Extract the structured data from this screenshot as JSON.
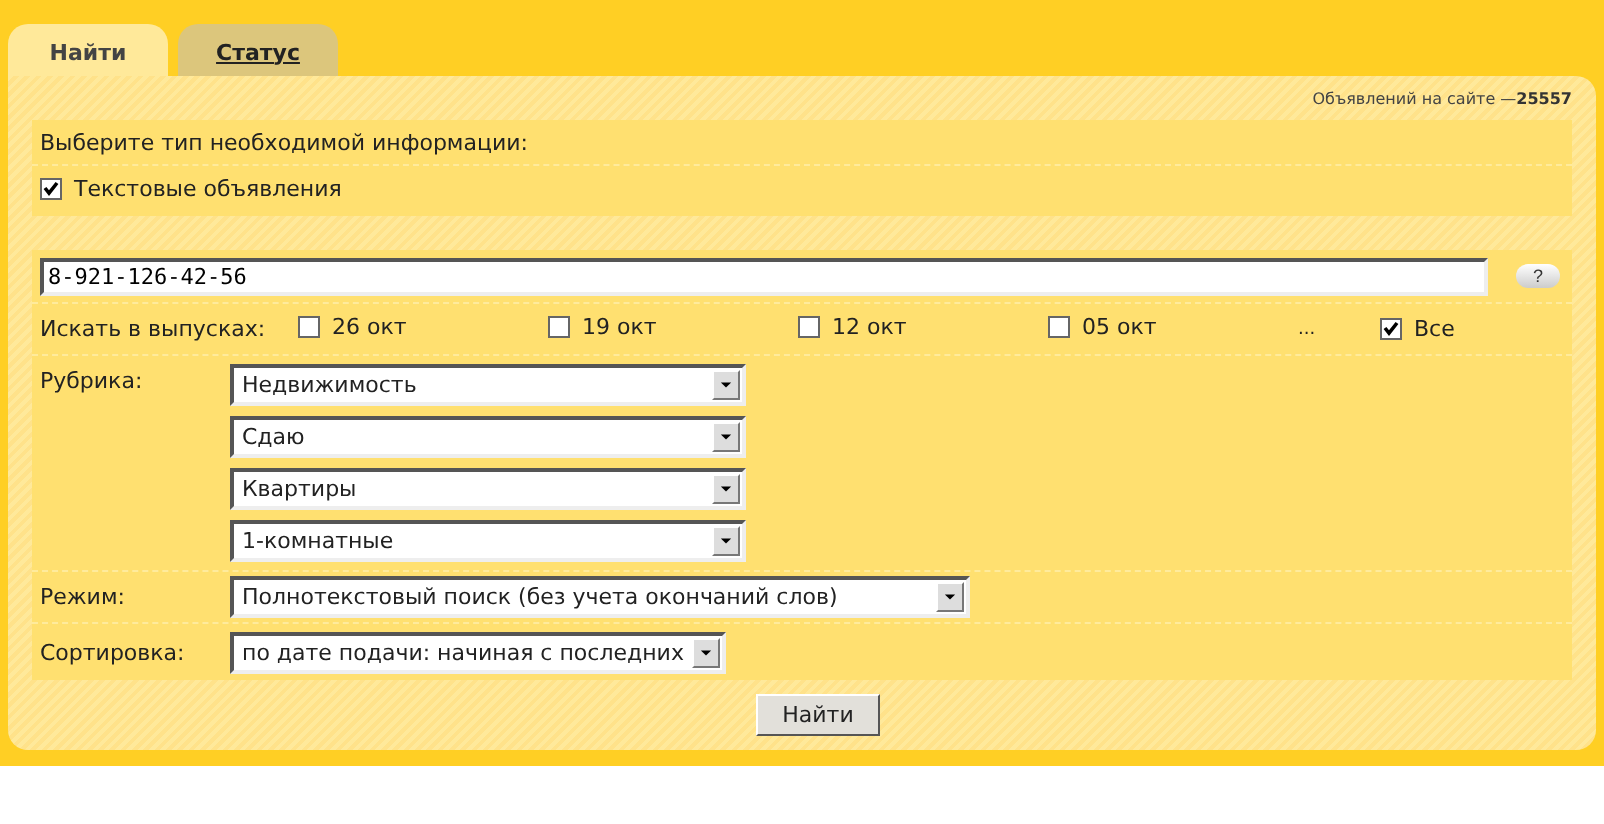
{
  "tabs": [
    {
      "label": "Найти",
      "selected": true
    },
    {
      "label": "Статус",
      "selected": false
    }
  ],
  "counter": {
    "label": "Объявлений на сайте —",
    "value": "25557"
  },
  "info_type": {
    "prompt": "Выберите тип необходимой информации:",
    "options": [
      {
        "label": "Текстовые объявления",
        "checked": true
      }
    ]
  },
  "query": {
    "value": "8-921-126-42-56",
    "help": "?"
  },
  "issues": {
    "label": "Искать в выпусках:",
    "options": [
      {
        "label": "26 окт",
        "checked": false
      },
      {
        "label": "19 окт",
        "checked": false
      },
      {
        "label": "12 окт",
        "checked": false
      },
      {
        "label": "05 окт",
        "checked": false
      }
    ],
    "ellipsis": "...",
    "all": {
      "label": "Все",
      "checked": true
    }
  },
  "rubric": {
    "label": "Рубрика:",
    "selects": [
      "Недвижимость",
      "Сдаю",
      "Квартиры",
      "1-комнатные"
    ]
  },
  "mode": {
    "label": "Режим:",
    "value": "Полнотекстовый поиск (без учета окончаний слов)"
  },
  "sort": {
    "label": "Сортировка:",
    "value": "по дате подачи: начиная с последних"
  },
  "submit": "Найти"
}
